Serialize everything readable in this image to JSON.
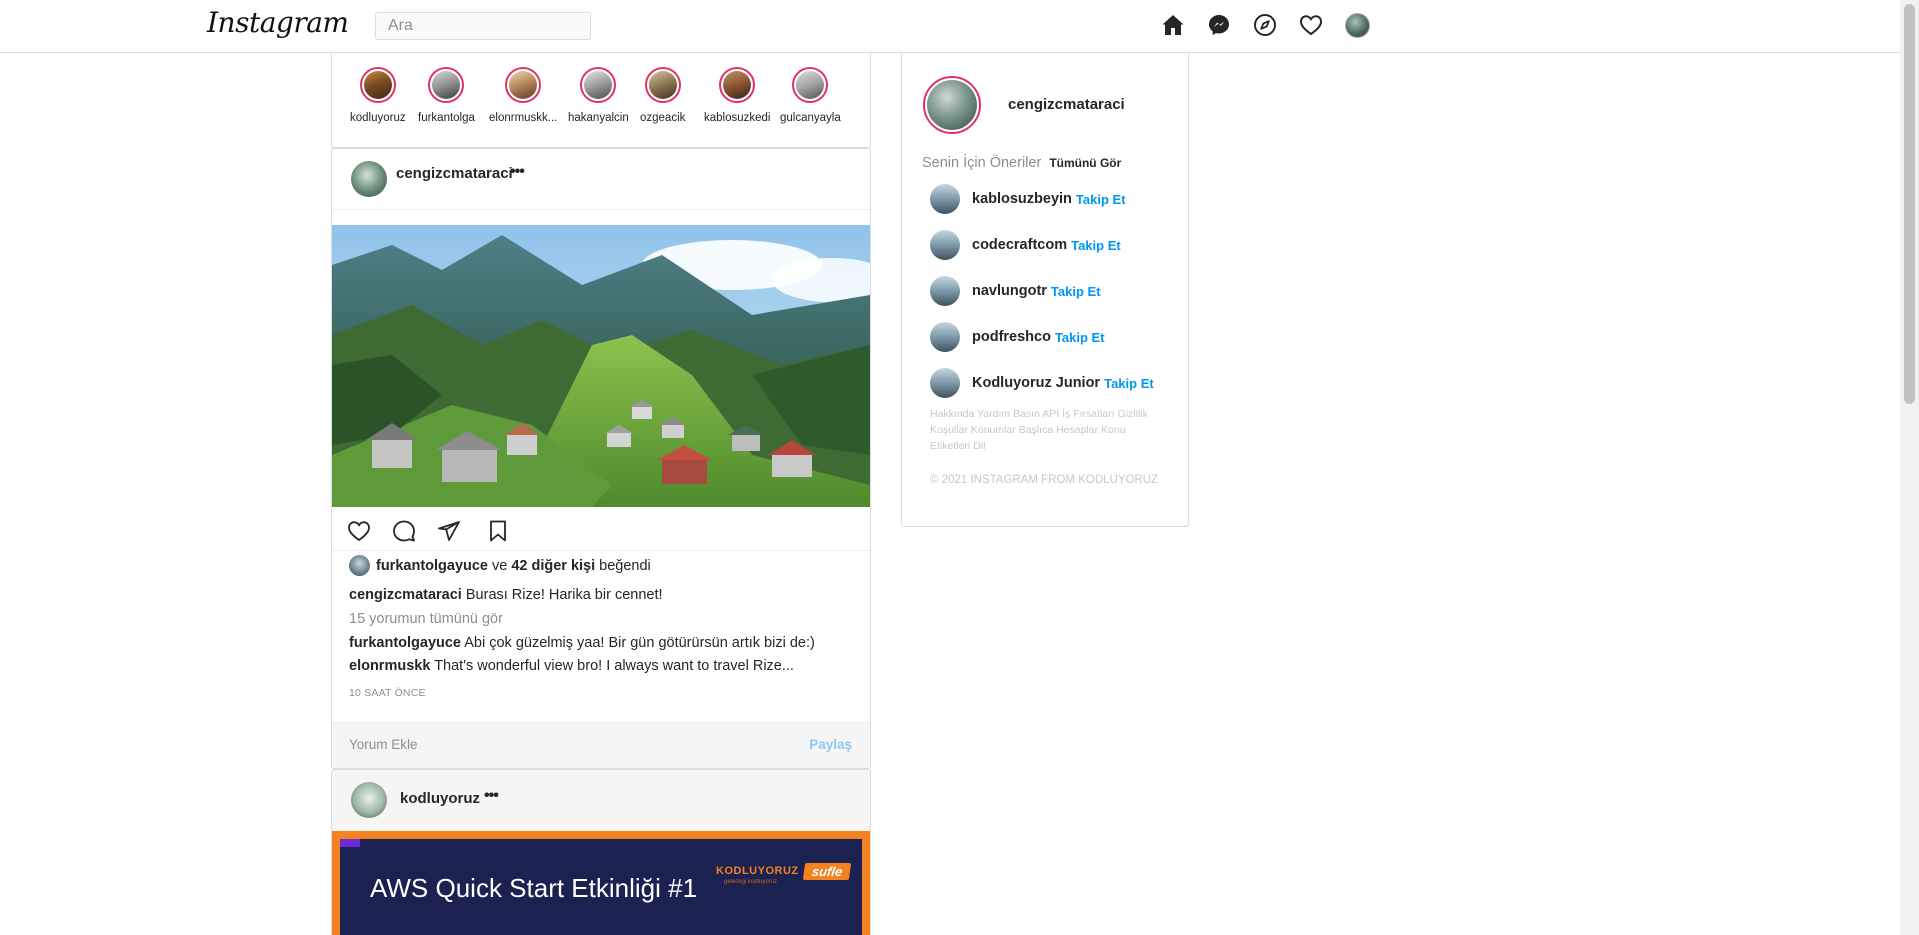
{
  "header": {
    "logo": "Instagram",
    "search_placeholder": "Ara",
    "icons": [
      "home-icon",
      "messenger-icon",
      "explore-icon",
      "heart-icon",
      "profile-avatar"
    ]
  },
  "stories": [
    {
      "username": "kodluyoruz"
    },
    {
      "username": "furkantolga"
    },
    {
      "username": "elonrmuskk..."
    },
    {
      "username": "hakanyalcin"
    },
    {
      "username": "ozgeacik"
    },
    {
      "username": "kablosuzkedi"
    },
    {
      "username": "gulcanyayla"
    }
  ],
  "post": {
    "username": "cengizcmataraci",
    "more": "•••",
    "likes": {
      "user": "furkantolgayuce",
      "connector": "ve",
      "others": "42 diğer kişi",
      "suffix": "beğendi"
    },
    "caption": {
      "user": "cengizcmataraci",
      "text": "Burası Rize! Harika bir cennet!"
    },
    "view_comments": "15 yorumun tümünü gör",
    "comments": [
      {
        "user": "furkantolgayuce",
        "text": "Abi çok güzelmiş yaa! Bir gün götürürsün artık bizi de:)"
      },
      {
        "user": "elonrmuskk",
        "text": "That's wonderful view bro! I always want to travel Rize..."
      }
    ],
    "time": "10 SAAT ÖNCE",
    "comment_placeholder": "Yorum Ekle",
    "share": "Paylaş"
  },
  "post2": {
    "username": "kodluyoruz",
    "more": "•••",
    "banner_title": "AWS Quick Start Etkinliği #1",
    "banner_logo": "KODLUYORUZ",
    "banner_sub": "gelecegi kodluyoruz",
    "banner_badge": "sufle"
  },
  "sidebar": {
    "username": "cengizcmataraci",
    "suggestions_title": "Senin İçin Öneriler",
    "see_all": "Tümünü Gör",
    "follow_label": "Takip Et",
    "suggestions": [
      {
        "name": "kablosuzbeyin"
      },
      {
        "name": "codecraftcom"
      },
      {
        "name": "navlungotr"
      },
      {
        "name": "podfreshco"
      },
      {
        "name": "Kodluyoruz Junior"
      }
    ],
    "footer_links": [
      "Hakkında",
      "Yardım",
      "Basın",
      "API",
      "İş Fırsatları",
      "Gizlilik",
      "Koşullar",
      "Konumlar",
      "Başlıca Hesaplar",
      "Konu Etiketleri",
      "Dil"
    ],
    "copyright": "© 2021 INSTAGRAM FROM KODLUYORUZ"
  },
  "colors": {
    "story_ring": "#e1306c",
    "link_blue": "#0095f6",
    "share_blue": "#8ec7f5",
    "border": "#dbdbdb"
  }
}
